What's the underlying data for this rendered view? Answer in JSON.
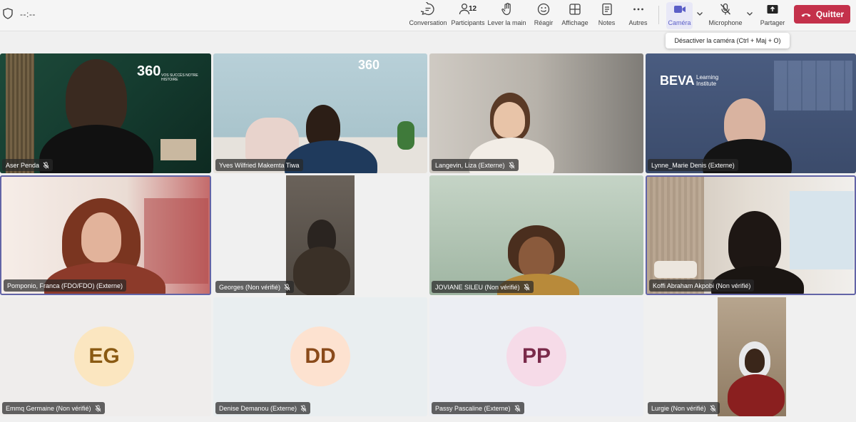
{
  "call": {
    "timer": "--:--"
  },
  "toolbar": {
    "conversation": "Conversation",
    "participants": "Participants",
    "participants_count": "12",
    "raise_hand": "Lever la main",
    "react": "Réagir",
    "view": "Affichage",
    "notes": "Notes",
    "more": "Autres",
    "camera": "Caméra",
    "microphone": "Microphone",
    "share": "Partager",
    "quit": "Quitter"
  },
  "tooltip": "Désactiver la caméra (Ctrl + Maj + O)",
  "tiles": [
    {
      "name": "Aser Penda"
    },
    {
      "name": "Yves Wilfried Makemta Tiwa"
    },
    {
      "name": "Langevin, Liza (Externe)"
    },
    {
      "name": "Lynne_Marie Denis (Externe)"
    },
    {
      "name": "Pomponio, Franca (FDO/FDO) (Externe)"
    },
    {
      "name": "Georges (Non vérifié)"
    },
    {
      "name": "JOVIANE SILEU (Non vérifié)"
    },
    {
      "name": "Koffi Abraham Akpobi (Non vérifié)"
    },
    {
      "name": "Emmq Germaine (Non vérifié)",
      "initials": "EG"
    },
    {
      "name": "Denise Demanou (Externe)",
      "initials": "DD"
    },
    {
      "name": "Passy Pascaline (Externe)",
      "initials": "PP"
    },
    {
      "name": "Lurgie (Non vérifié)"
    }
  ],
  "backgrounds": {
    "brand_1": "360",
    "brand_1_sub": "VOS SUCCÈS NOTRE HISTOIRE",
    "brand_2": "BEVA",
    "brand_2_sub": "Learning Institute"
  },
  "colors": {
    "accent": "#5b5fc7",
    "quit": "#c4314b",
    "avatar_eg": "#fbe6c0",
    "avatar_dd": "#fde2d0",
    "avatar_pp": "#f6dbe8"
  }
}
